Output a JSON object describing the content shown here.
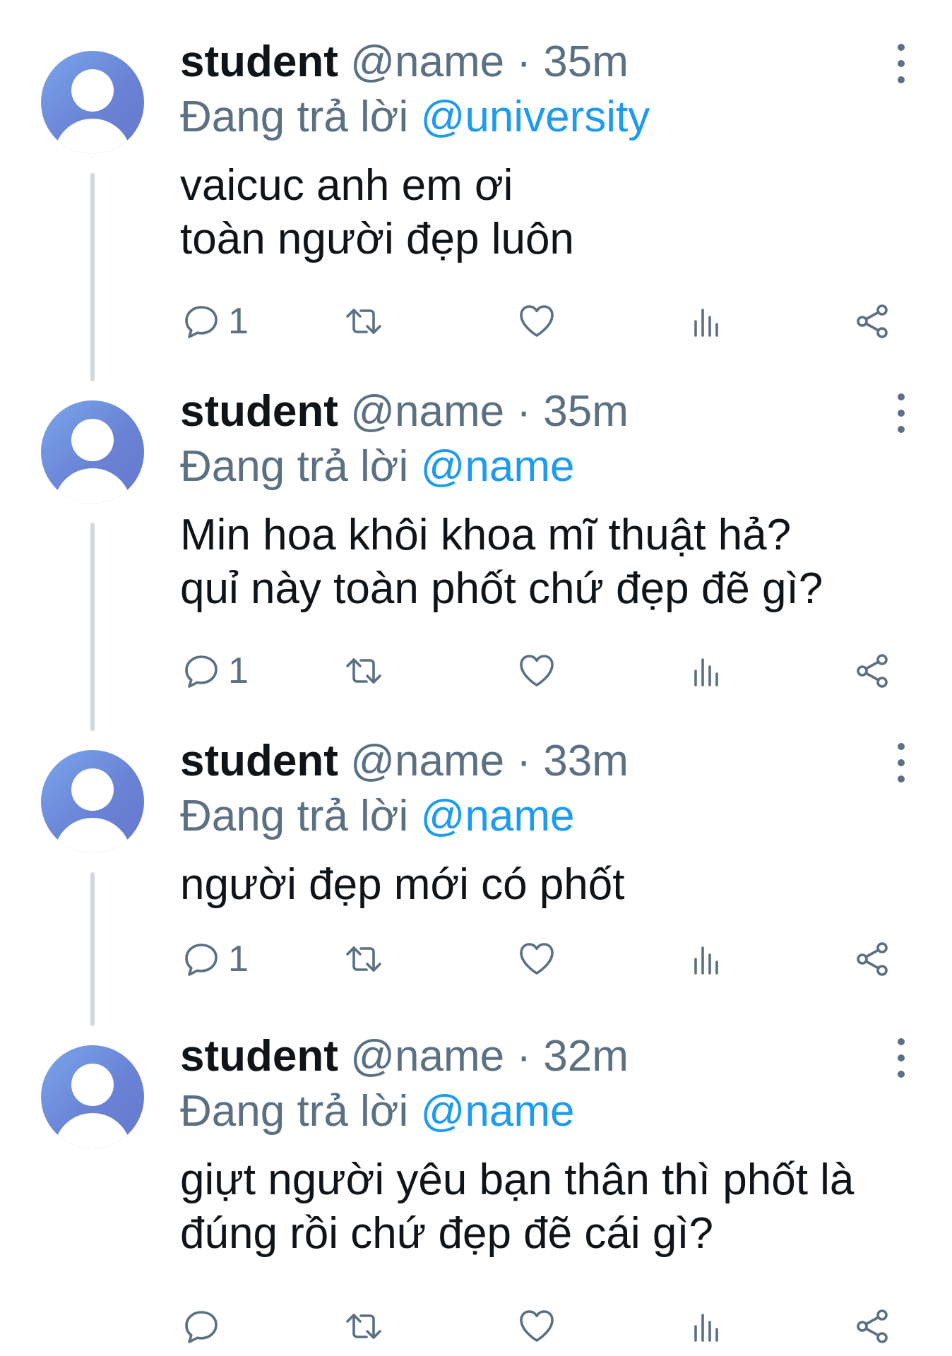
{
  "tweets": [
    {
      "display_name": "student",
      "handle": "@name",
      "separator": "·",
      "time": "35m",
      "replying_prefix": "Đang trả lời",
      "replying_to": "@university",
      "text": "vaicuc anh em ơi\ntoàn người đẹp luôn",
      "reply_count": "1",
      "icons": [
        "avatar-person-icon",
        "more-vertical-icon",
        "reply-icon",
        "retweet-icon",
        "like-heart-icon",
        "views-chart-icon",
        "share-icon"
      ]
    },
    {
      "display_name": "student",
      "handle": "@name",
      "separator": "·",
      "time": "35m",
      "replying_prefix": "Đang trả lời",
      "replying_to": "@name",
      "text": "Min hoa khôi khoa mĩ thuật hả?\nquỉ này toàn phốt chứ đẹp đẽ gì?",
      "reply_count": "1"
    },
    {
      "display_name": "student",
      "handle": "@name",
      "separator": "·",
      "time": "33m",
      "replying_prefix": "Đang trả lời",
      "replying_to": "@name",
      "text": "người đẹp mới có phốt",
      "reply_count": "1"
    },
    {
      "display_name": "student",
      "handle": "@name",
      "separator": "·",
      "time": "32m",
      "replying_prefix": "Đang trả lời",
      "replying_to": "@name",
      "text": "giựt người yêu bạn thân thì phốt là\nđúng rồi chứ đẹp đẽ cái gì?",
      "reply_count": ""
    }
  ],
  "colors": {
    "text": "#0f1419",
    "muted": "#5b7083",
    "mention": "#1d9bf0",
    "connector": "#d4d8dc",
    "avatar_start": "#7aa6ea",
    "avatar_end": "#6677cc"
  }
}
